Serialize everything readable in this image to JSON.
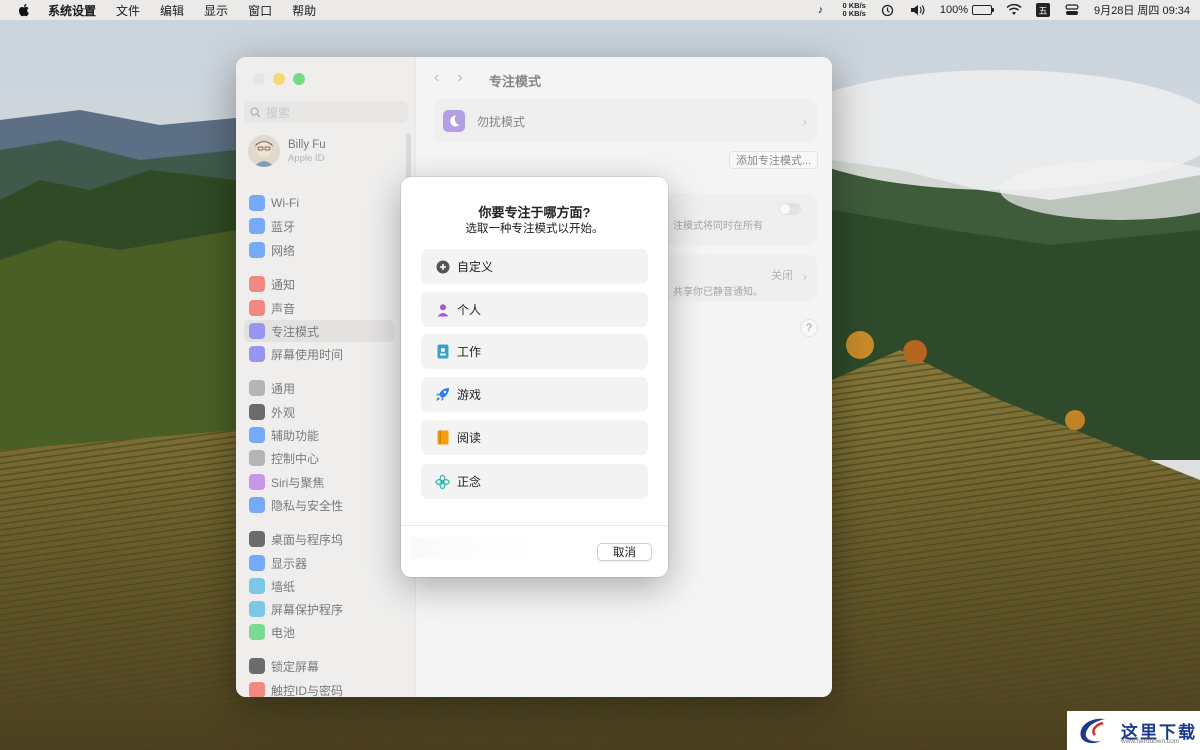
{
  "menubar": {
    "app_name": "系统设置",
    "menus": [
      "文件",
      "编辑",
      "显示",
      "窗口",
      "帮助"
    ],
    "net_up": "0 KB/s",
    "net_down": "0 KB/s",
    "battery": "100%",
    "ime": "五",
    "datetime": "9月28日 周四  09:34"
  },
  "sidebar": {
    "search_placeholder": "搜索",
    "profile": {
      "name": "Billy Fu",
      "sub": "Apple ID"
    },
    "items": [
      {
        "label": "Wi-Fi",
        "color": "#2f7cf6",
        "icon": "wifi-icon"
      },
      {
        "label": "蓝牙",
        "color": "#2f7cf6",
        "icon": "bluetooth-icon"
      },
      {
        "label": "网络",
        "color": "#2f7cf6",
        "icon": "globe-icon"
      },
      {
        "label": "通知",
        "color": "#e94b3c",
        "icon": "bell-icon"
      },
      {
        "label": "声音",
        "color": "#e94b3c",
        "icon": "speaker-icon"
      },
      {
        "label": "专注模式",
        "color": "#5e5ce6",
        "icon": "moon-icon"
      },
      {
        "label": "屏幕使用时间",
        "color": "#5e5ce6",
        "icon": "hourglass-icon"
      },
      {
        "label": "通用",
        "color": "#8e8e93",
        "icon": "gear-icon"
      },
      {
        "label": "外观",
        "color": "#1c1c1e",
        "icon": "appearance-icon"
      },
      {
        "label": "辅助功能",
        "color": "#2f7cf6",
        "icon": "accessibility-icon"
      },
      {
        "label": "控制中心",
        "color": "#8e8e93",
        "icon": "control-center-icon"
      },
      {
        "label": "Siri与聚焦",
        "color": "#b05ce0",
        "icon": "siri-icon"
      },
      {
        "label": "隐私与安全性",
        "color": "#2f7cf6",
        "icon": "hand-icon"
      },
      {
        "label": "桌面与程序坞",
        "color": "#1c1c1e",
        "icon": "dock-icon"
      },
      {
        "label": "显示器",
        "color": "#2f7cf6",
        "icon": "sun-icon"
      },
      {
        "label": "墙纸",
        "color": "#35aadc",
        "icon": "wallpaper-icon"
      },
      {
        "label": "屏幕保护程序",
        "color": "#35aadc",
        "icon": "screensaver-icon"
      },
      {
        "label": "电池",
        "color": "#34c759",
        "icon": "battery-icon"
      },
      {
        "label": "锁定屏幕",
        "color": "#1c1c1e",
        "icon": "lock-icon"
      },
      {
        "label": "触控ID与密码",
        "color": "#e94b3c",
        "icon": "fingerprint-icon"
      }
    ]
  },
  "content": {
    "title": "专注模式",
    "dnd_label": "勿扰模式",
    "add_focus": "添加专注模式...",
    "card2_text": "注模式将同时在所有",
    "card3_status": "关闭",
    "card3_text": "共享你已静音通知。",
    "help": "?"
  },
  "modal": {
    "title": "你要专注于哪方面?",
    "subtitle": "选取一种专注模式以开始。",
    "options": [
      {
        "label": "自定义",
        "icon": "plus-circle-icon",
        "color": "#555555"
      },
      {
        "label": "个人",
        "icon": "person-icon",
        "color": "#a855d6"
      },
      {
        "label": "工作",
        "icon": "id-badge-icon",
        "color": "#3aa0c8"
      },
      {
        "label": "游戏",
        "icon": "rocket-icon",
        "color": "#2f7cf6"
      },
      {
        "label": "阅读",
        "icon": "book-icon",
        "color": "#f59e0b"
      },
      {
        "label": "正念",
        "icon": "flower-icon",
        "color": "#2bb5b0"
      }
    ],
    "cancel": "取消"
  },
  "watermark": {
    "text": "这里下载",
    "url": "www.herodown.com"
  }
}
